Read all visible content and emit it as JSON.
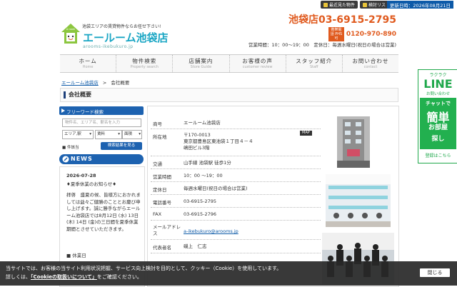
{
  "topbar": {
    "links": [
      {
        "label": "最近見た物件",
        "icon": "history-icon"
      },
      {
        "label": "検討リスト",
        "icon": "list-icon"
      }
    ],
    "date": "更新日時：2026年08月21日"
  },
  "header": {
    "tagline": "池袋エリアの賃貸物件ならお任せ下さい!",
    "logo_text": "エールーム池袋店",
    "logo_sub": "arooms-ikebukuro.jp",
    "logo_house_text": "A room",
    "phone": "池袋店03-6915-2795",
    "freedial_badge": "携帯電話 PHS可",
    "freedial": "0120-970-890",
    "hours": "営業時間：10：00〜19：00　定休日：毎週水曜日(祝日の場合は営業)"
  },
  "nav": [
    {
      "jp": "ホーム",
      "en": "Home"
    },
    {
      "jp": "物件検索",
      "en": "Property search"
    },
    {
      "jp": "店舗案内",
      "en": "Store Guide"
    },
    {
      "jp": "お客様の声",
      "en": "customer review"
    },
    {
      "jp": "スタッフ紹介",
      "en": "Staff"
    },
    {
      "jp": "お問い合わせ",
      "en": "contact"
    }
  ],
  "breadcrumb": {
    "home": "エールーム池袋店",
    "sep": ">",
    "current": "会社概要"
  },
  "page_title": "会社概要",
  "search": {
    "heading": "フリーワード検索",
    "placeholder": "物件名、エリア名、駅名を入力",
    "selects": [
      "エリア,駅",
      "賃料",
      "面積"
    ],
    "count_label": "件該当",
    "button": "検索結果を見る"
  },
  "news": {
    "heading": "NEWS",
    "date": "2026-07-28",
    "title": "♦夏季休業のお知らせ♦",
    "body": "拝啓　盛夏の候、皆様方におかれましては益々ご健勝のこととお慶び申し上げます。誠に勝手ながらエールーム池袋店では8月12日 (水) 13日 (木) 14日 (金)の三日間を夏季休業期間とさせていただきます。",
    "holiday": "■ 休業日"
  },
  "company": {
    "rows": [
      {
        "k": "商号",
        "v": "エールーム池袋店"
      },
      {
        "k": "所在地",
        "v": "〒170-0013\n東京都豊島区東池袋１丁目４－４\n嶋田ビル3階",
        "badge": "MAP"
      },
      {
        "k": "交通",
        "v": "山手線 池袋駅 徒歩1分"
      },
      {
        "k": "営業時間",
        "v": "10：00 〜19：00"
      },
      {
        "k": "定休日",
        "v": "毎週水曜日(祝日の場合は営業)"
      },
      {
        "k": "電話番号",
        "v": "03-6915-2795"
      },
      {
        "k": "FAX",
        "v": "03-6915-2796"
      },
      {
        "k": "メールアドレス",
        "v": "a-ikebukuro@arooms.jp"
      },
      {
        "k": "代表者名",
        "v": "磯上　仁志"
      }
    ]
  },
  "line_banner": {
    "l1": "ラクラク",
    "l2": "LINE",
    "l3": "お問い合わせ",
    "l4": "チャットで",
    "l5": "簡単",
    "l6": "お部屋",
    "l7": "探し",
    "l8": "登録はこちら"
  },
  "cookie": {
    "text1": "当サイトでは、お客様の当サイト利用状況把握、サービス向上検討を目的として、クッキー（Cookie）を使用しています。",
    "text2_pre": "詳しくは、",
    "link": "「Cookieの取扱いについて」",
    "text2_post": "をご確認ください。",
    "close": "閉じる"
  },
  "colors": {
    "brand": "#1d62b0",
    "accent": "#e05a1e",
    "line_green": "#22b04f"
  }
}
